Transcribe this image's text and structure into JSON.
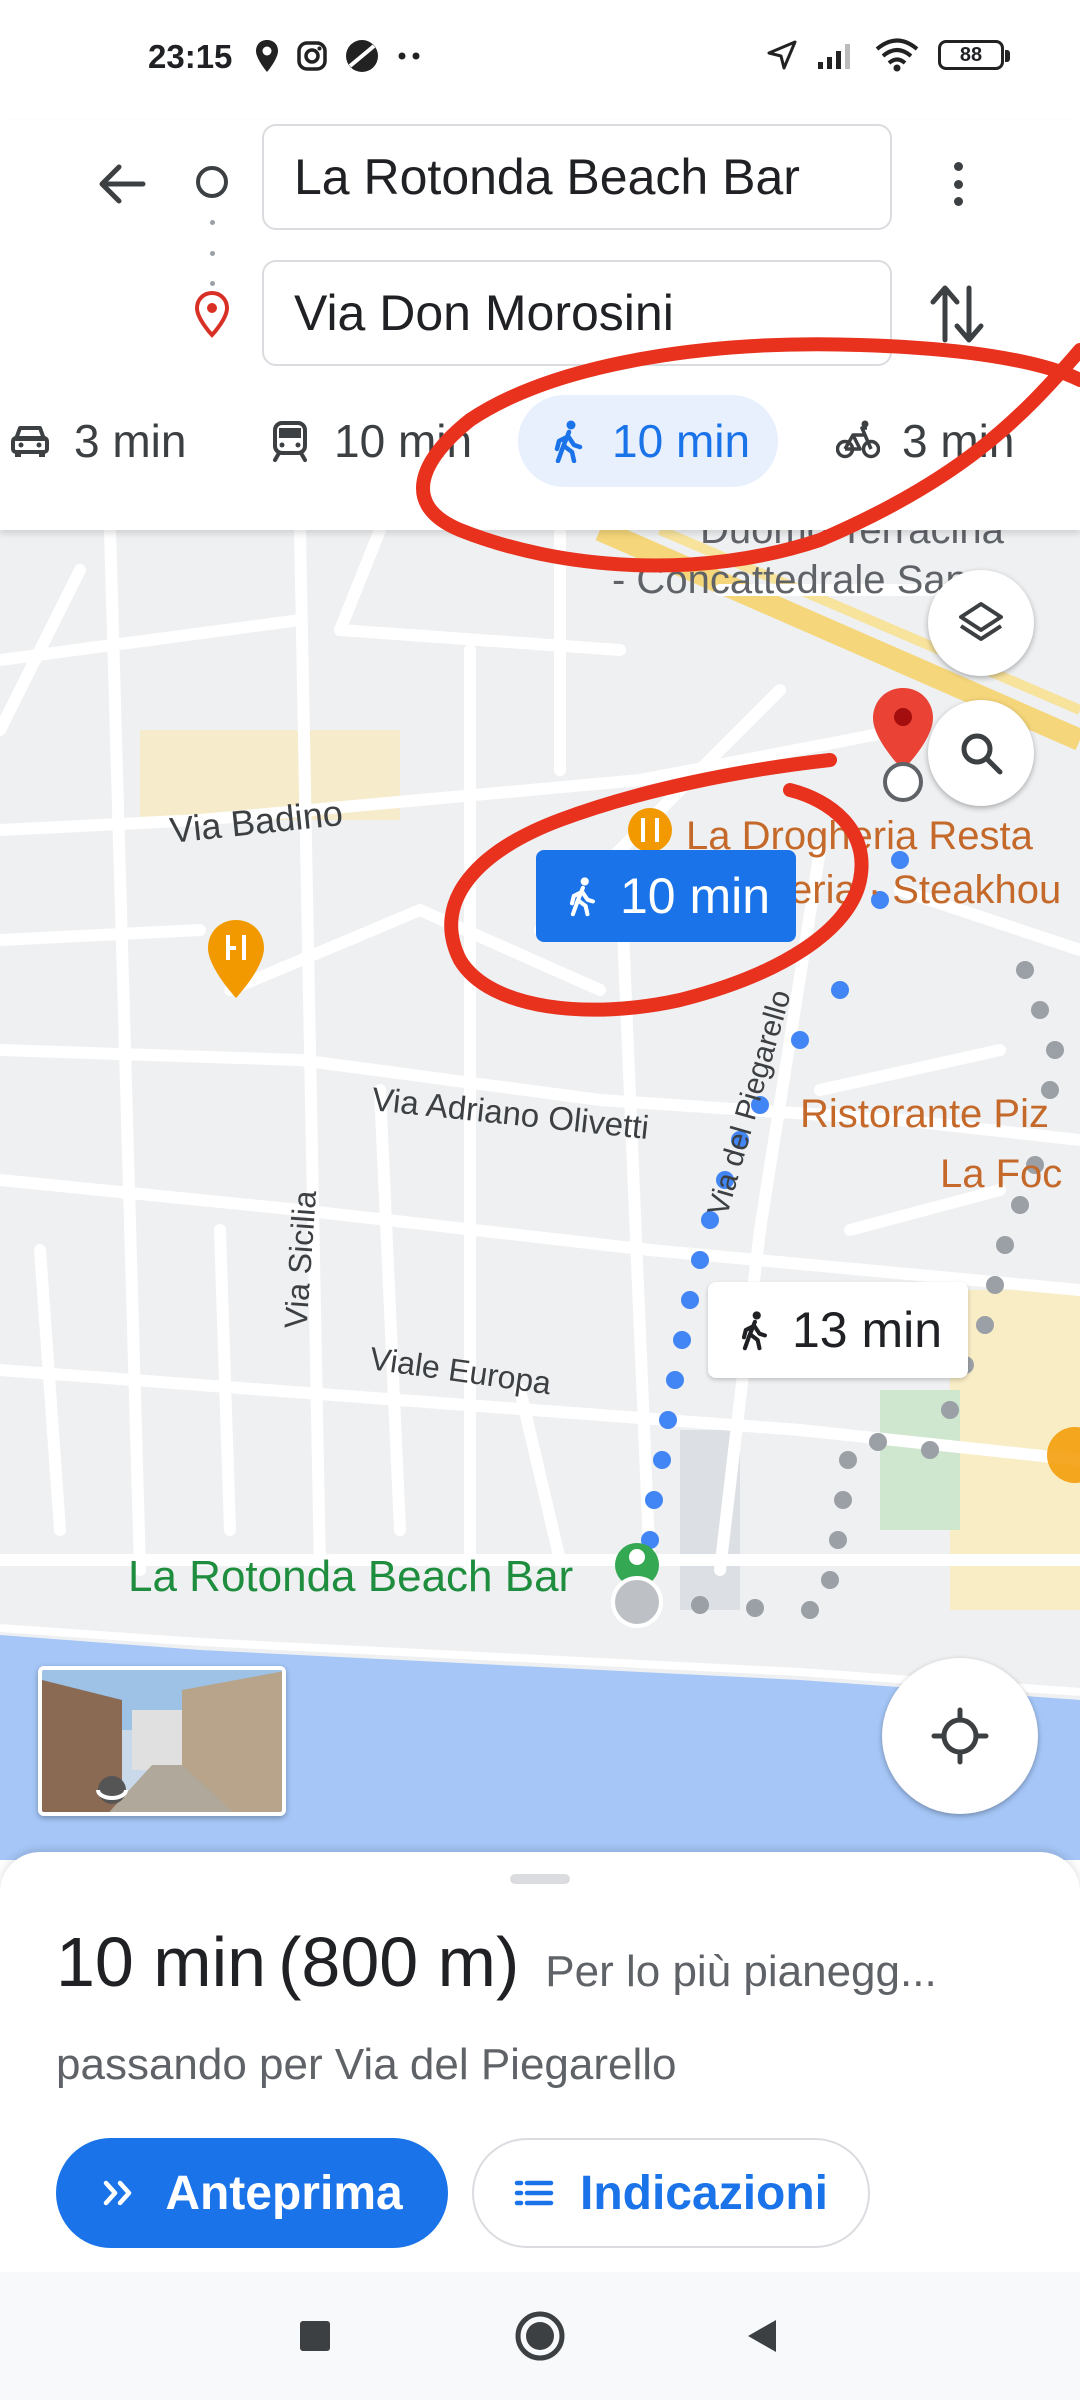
{
  "status_bar": {
    "time": "23:15",
    "icons": [
      "location-icon",
      "instagram-icon",
      "app-icon",
      "more-dots"
    ],
    "right_icons": [
      "navigation-arrow-icon",
      "signal-icon",
      "wifi-icon",
      "battery-icon"
    ],
    "battery": "88"
  },
  "directions": {
    "origin": "La Rotonda Beach Bar",
    "destination": "Via Don Morosini"
  },
  "modes": [
    {
      "mode": "drive",
      "label": "3 min"
    },
    {
      "mode": "transit",
      "label": "10 min"
    },
    {
      "mode": "walk",
      "label": "10 min",
      "selected": true
    },
    {
      "mode": "bike",
      "label": "3 min"
    }
  ],
  "map": {
    "streets": {
      "badino": "Via Badino",
      "olivetti": "Via Adriano Olivetti",
      "sicilia": "Via Sicilia",
      "europa": "Viale Europa",
      "piegarello": "Via del Piegarello"
    },
    "places": {
      "cathedral_1": "Duomo Terracina",
      "cathedral_2": "- Concattedrale San",
      "drogheria_1": "La Drogheria Resta",
      "drogheria_2": "eria · Steakhou",
      "ristorante_1": "Ristorante Piz",
      "ristorante_2": "La Foc",
      "start": "La Rotonda Beach Bar"
    },
    "route_selected": "10 min",
    "route_alternative": "13 min"
  },
  "summary": {
    "time": "10 min",
    "distance": "(800 m)",
    "terrain": "Per lo più pianegg...",
    "via": "passando per Via del Piegarello",
    "preview_label": "Anteprima",
    "directions_label": "Indicazioni"
  },
  "colors": {
    "accent": "#1a73e8",
    "selected_tab_bg": "#e8f0fe",
    "annotation_red": "#e8321e",
    "poi_orange": "#c5692b",
    "start_green": "#1e8e3e",
    "water": "#a5c6f7"
  }
}
